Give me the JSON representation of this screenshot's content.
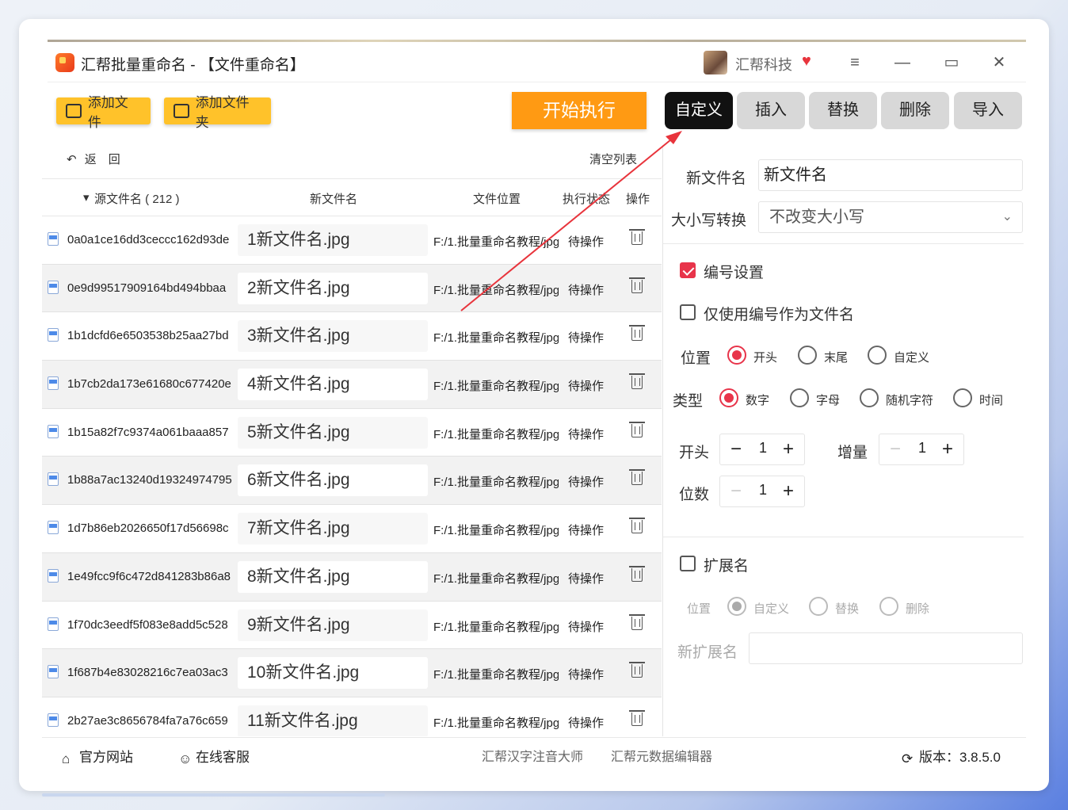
{
  "window": {
    "title": "汇帮批量重命名 - 【文件重命名】",
    "user_name": "汇帮科技"
  },
  "toolbar": {
    "add_file": "添加文件",
    "add_folder": "添加文件夹",
    "start": "开始执行"
  },
  "tabs": [
    "自定义",
    "插入",
    "替换",
    "删除",
    "导入"
  ],
  "list": {
    "back": "返　回",
    "clear": "清空列表",
    "headers": {
      "source": "源文件名 ( 212 )",
      "new_name": "新文件名",
      "location": "文件位置",
      "status": "执行状态",
      "action": "操作"
    },
    "rows": [
      {
        "src": "0a0a1ce16dd3ceccc162d93de",
        "new": "1新文件名.jpg",
        "loc": "F:/1.批量重命名教程/jpg",
        "status": "待操作"
      },
      {
        "src": "0e9d99517909164bd494bbaa",
        "new": "2新文件名.jpg",
        "loc": "F:/1.批量重命名教程/jpg",
        "status": "待操作"
      },
      {
        "src": "1b1dcfd6e6503538b25aa27bd",
        "new": "3新文件名.jpg",
        "loc": "F:/1.批量重命名教程/jpg",
        "status": "待操作"
      },
      {
        "src": "1b7cb2da173e61680c677420e",
        "new": "4新文件名.jpg",
        "loc": "F:/1.批量重命名教程/jpg",
        "status": "待操作"
      },
      {
        "src": "1b15a82f7c9374a061baaa857",
        "new": "5新文件名.jpg",
        "loc": "F:/1.批量重命名教程/jpg",
        "status": "待操作"
      },
      {
        "src": "1b88a7ac13240d19324974795",
        "new": "6新文件名.jpg",
        "loc": "F:/1.批量重命名教程/jpg",
        "status": "待操作"
      },
      {
        "src": "1d7b86eb2026650f17d56698c",
        "new": "7新文件名.jpg",
        "loc": "F:/1.批量重命名教程/jpg",
        "status": "待操作"
      },
      {
        "src": "1e49fcc9f6c472d841283b86a8",
        "new": "8新文件名.jpg",
        "loc": "F:/1.批量重命名教程/jpg",
        "status": "待操作"
      },
      {
        "src": "1f70dc3eedf5f083e8add5c528",
        "new": "9新文件名.jpg",
        "loc": "F:/1.批量重命名教程/jpg",
        "status": "待操作"
      },
      {
        "src": "1f687b4e83028216c7ea03ac3",
        "new": "10新文件名.jpg",
        "loc": "F:/1.批量重命名教程/jpg",
        "status": "待操作"
      },
      {
        "src": "2b27ae3c8656784fa7a76c659",
        "new": "11新文件名.jpg",
        "loc": "F:/1.批量重命名教程/jpg",
        "status": "待操作"
      }
    ]
  },
  "panel": {
    "new_name_label": "新文件名",
    "new_name_value": "新文件名",
    "case_label": "大小写转换",
    "case_value": "不改变大小写",
    "numbering_label": "编号设置",
    "numbering_checked": true,
    "only_number_label": "仅使用编号作为文件名",
    "only_number_checked": false,
    "position_label": "位置",
    "position_options": [
      "开头",
      "末尾",
      "自定义"
    ],
    "position_selected": "开头",
    "type_label": "类型",
    "type_options": [
      "数字",
      "字母",
      "随机字符",
      "时间"
    ],
    "type_selected": "数字",
    "start_label": "开头",
    "start_value": "1",
    "increment_label": "增量",
    "increment_value": "1",
    "digits_label": "位数",
    "digits_value": "1",
    "ext_label": "扩展名",
    "ext_checked": false,
    "ext_position_label": "位置",
    "ext_options": [
      "自定义",
      "替换",
      "删除"
    ],
    "ext_selected": "自定义",
    "new_ext_label": "新扩展名",
    "new_ext_value": ""
  },
  "footer": {
    "website": "官方网站",
    "support": "在线客服",
    "link1": "汇帮汉字注音大师",
    "link2": "汇帮元数据编辑器",
    "version": "版本：3.8.5.0"
  },
  "colors": {
    "accent": "#e8344a",
    "start_button": "#ff9a13",
    "toolbar_button": "#ffc22a",
    "active_tab": "#111111"
  }
}
